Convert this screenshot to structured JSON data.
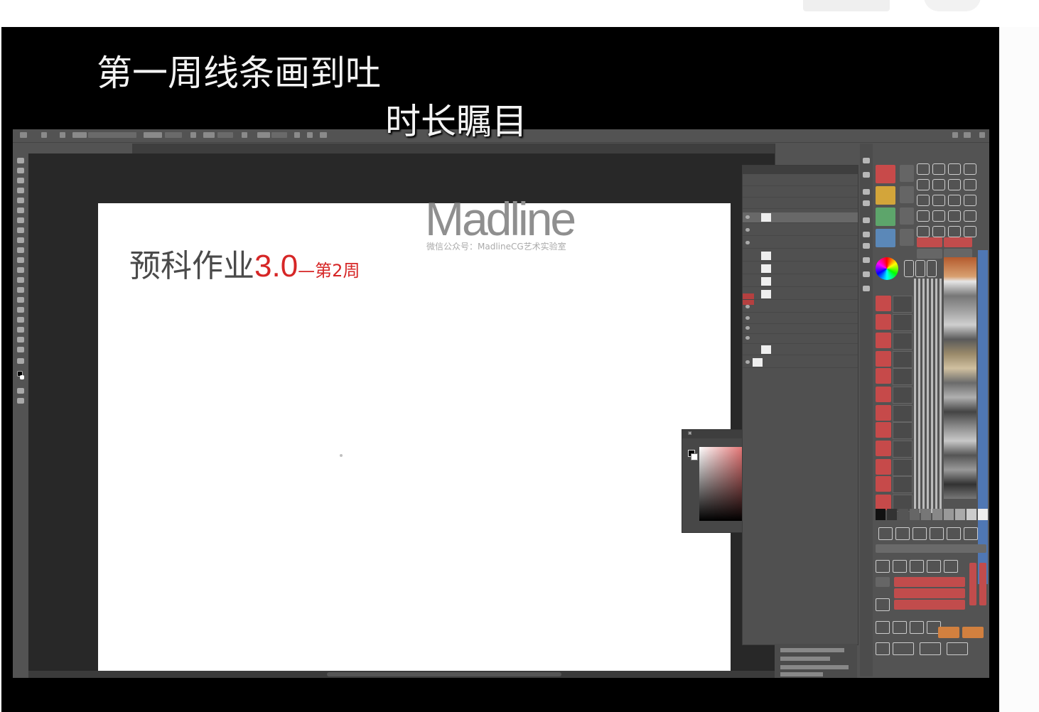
{
  "subtitles": {
    "line1": "第一周线条画到吐",
    "line2": "时长瞩目"
  },
  "canvas": {
    "logo_text": "Madline",
    "logo_subtext": "微信公众号：MadlineCG艺术实验室",
    "homework_title": "预科作业",
    "homework_version": "3.0",
    "homework_week": "—第2周"
  },
  "colors": {
    "accent_red": "#d62626",
    "ps_panel": "#535353",
    "ps_workspace": "#282828",
    "brush_stripe": "#4f77b4"
  },
  "icons": [
    "brush-icon",
    "eye-icon",
    "color-picker-icon",
    "gear-icon"
  ]
}
